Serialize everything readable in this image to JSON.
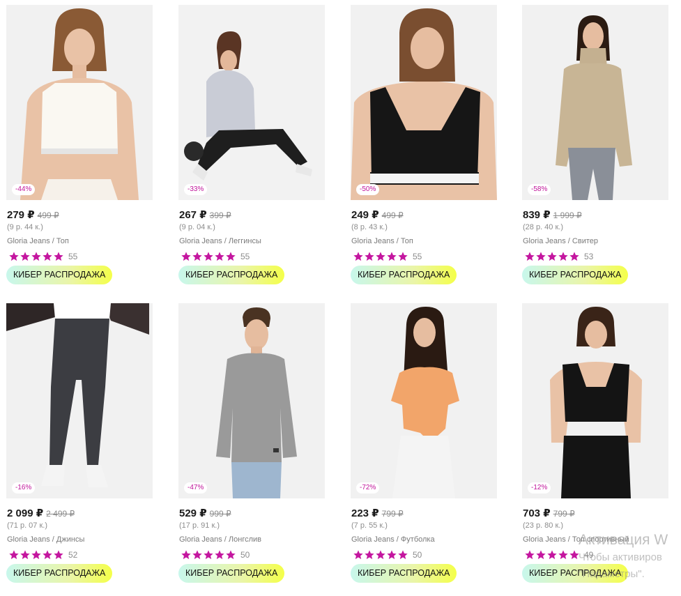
{
  "colors": {
    "discount_text": "#c0149a",
    "star": "#c4169f",
    "badge_gradient": [
      "#c8f7ec",
      "#f4ff49"
    ]
  },
  "products": [
    {
      "discount": "-44%",
      "price": "279 ₽",
      "old_price": "499 ₽",
      "installment": "(9 р. 44 к.)",
      "name": "Gloria Jeans / Топ",
      "rating": 5,
      "reviews": "55",
      "badge": "КИБЕР РАСПРОДАЖА",
      "image": "white-sport-top-model"
    },
    {
      "discount": "-33%",
      "price": "267 ₽",
      "old_price": "399 ₽",
      "installment": "(9 р. 04 к.)",
      "name": "Gloria Jeans / Леггинсы",
      "rating": 5,
      "reviews": "55",
      "badge": "КИБЕР РАСПРОДАЖА",
      "image": "leggings-stretch-model"
    },
    {
      "discount": "-50%",
      "price": "249 ₽",
      "old_price": "499 ₽",
      "installment": "(8 р. 43 к.)",
      "name": "Gloria Jeans / Топ",
      "rating": 5,
      "reviews": "55",
      "badge": "КИБЕР РАСПРОДАЖА",
      "image": "black-sport-top-model"
    },
    {
      "discount": "-58%",
      "price": "839 ₽",
      "old_price": "1 999 ₽",
      "installment": "(28 р. 40 к.)",
      "name": "Gloria Jeans / Свитер",
      "rating": 5,
      "reviews": "53",
      "badge": "КИБЕР РАСПРОДАЖА",
      "image": "beige-sweater-model"
    },
    {
      "discount": "-16%",
      "price": "2 099 ₽",
      "old_price": "2 499 ₽",
      "installment": "(71 р. 07 к.)",
      "name": "Gloria Jeans / Джинсы",
      "rating": 5,
      "reviews": "52",
      "badge": "КИБЕР РАСПРОДАЖА",
      "image": "grey-jeans-model"
    },
    {
      "discount": "-47%",
      "price": "529 ₽",
      "old_price": "999 ₽",
      "installment": "(17 р. 91 к.)",
      "name": "Gloria Jeans / Лонгслив",
      "rating": 5,
      "reviews": "50",
      "badge": "КИБЕР РАСПРОДАЖА",
      "image": "grey-longsleeve-model"
    },
    {
      "discount": "-72%",
      "price": "223 ₽",
      "old_price": "799 ₽",
      "installment": "(7 р. 55 к.)",
      "name": "Gloria Jeans / Футболка",
      "rating": 5,
      "reviews": "50",
      "badge": "КИБЕР РАСПРОДАЖА",
      "image": "orange-tshirt-model"
    },
    {
      "discount": "-12%",
      "price": "703 ₽",
      "old_price": "799 ₽",
      "installment": "(23 р. 80 к.)",
      "name": "Gloria Jeans / Топ спортивный",
      "rating": 5,
      "reviews": "49",
      "badge": "КИБЕР РАСПРОДАЖА",
      "image": "black-sport-top-leggings-model"
    }
  ],
  "watermark": {
    "title": "Активация W",
    "line1": "Чтобы активиров",
    "line2": "\"Параметры\"."
  }
}
